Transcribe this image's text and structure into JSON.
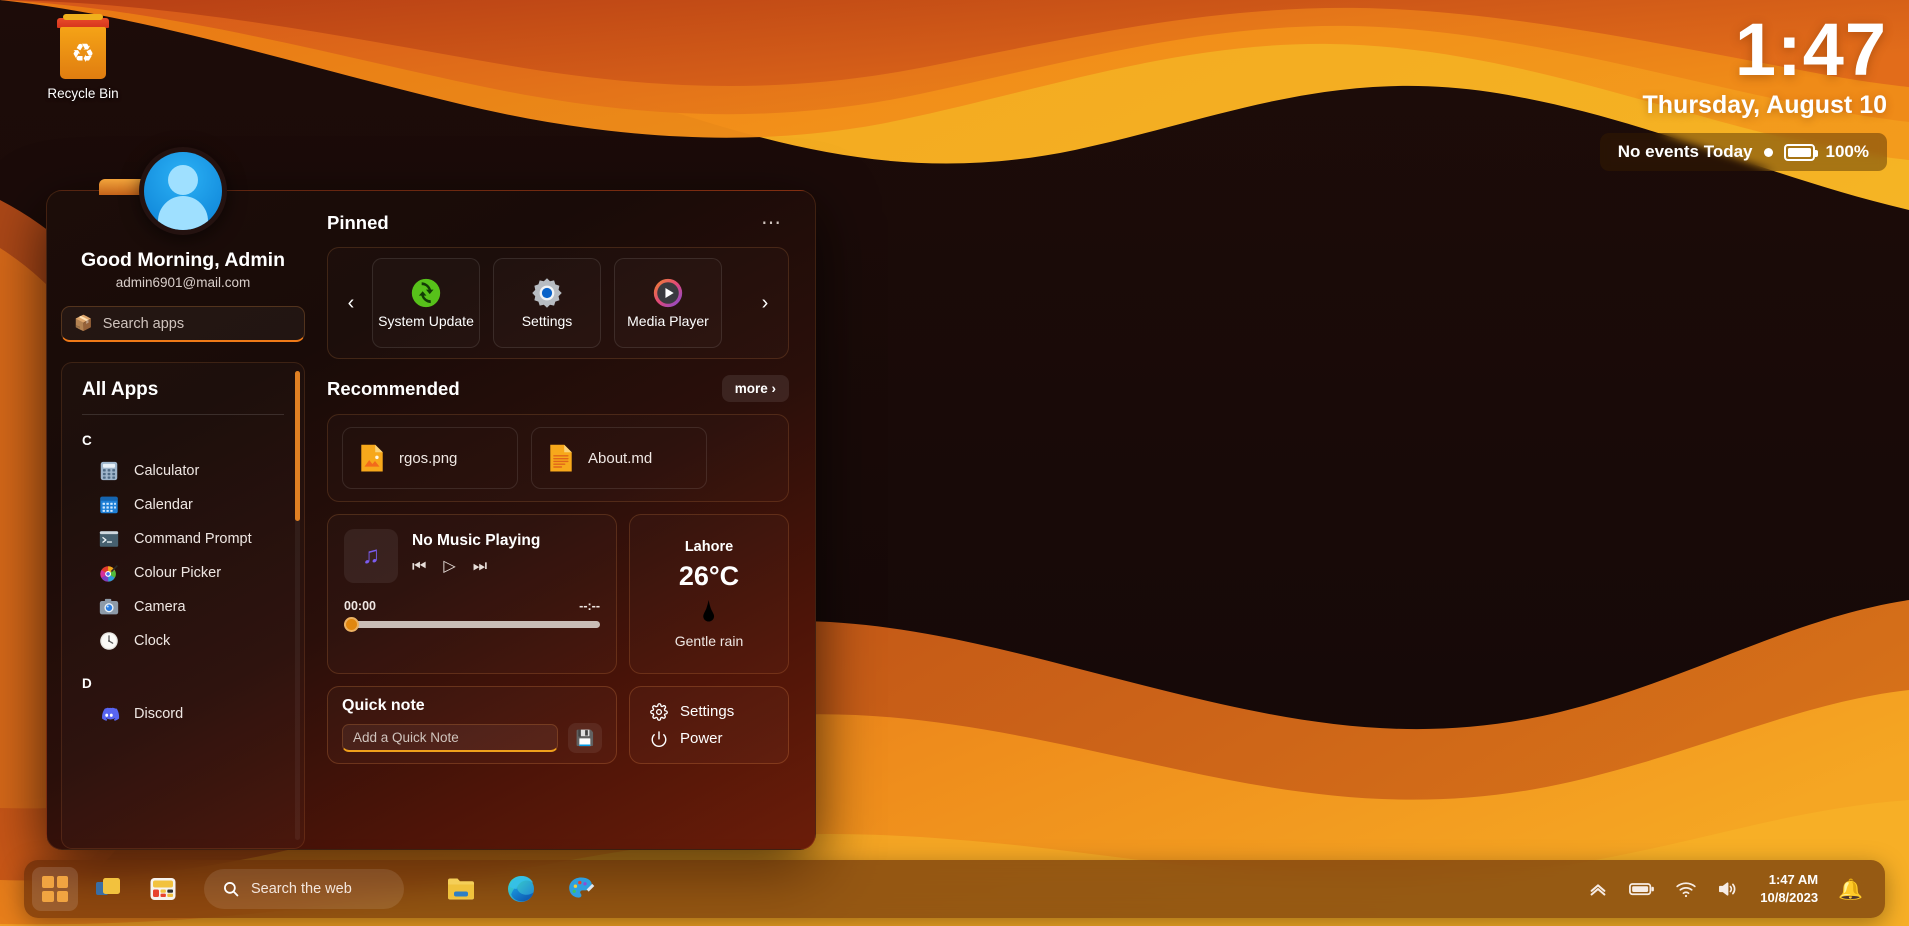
{
  "desktop": {
    "recycle_bin_label": "Recycle Bin",
    "recycle_bin_icon": "recycle-bin-icon"
  },
  "clock_widget": {
    "time": "1:47",
    "date": "Thursday, August 10",
    "events_text": "No events Today",
    "battery_percent": "100%",
    "battery_icon": "battery-full-icon"
  },
  "start_menu": {
    "user": {
      "greeting": "Good Morning, Admin",
      "email": "admin6901@mail.com",
      "avatar_icon": "user-avatar-icon"
    },
    "search": {
      "placeholder": "Search apps",
      "icon": "app-stack-icon"
    },
    "all_apps": {
      "title": "All Apps",
      "groups": [
        {
          "letter": "C",
          "apps": [
            {
              "name": "Calculator",
              "icon": "calculator-icon"
            },
            {
              "name": "Calendar",
              "icon": "calendar-icon"
            },
            {
              "name": "Command Prompt",
              "icon": "terminal-icon"
            },
            {
              "name": "Colour Picker",
              "icon": "color-wheel-icon"
            },
            {
              "name": "Camera",
              "icon": "camera-icon"
            },
            {
              "name": "Clock",
              "icon": "clock-icon"
            }
          ]
        },
        {
          "letter": "D",
          "apps": [
            {
              "name": "Discord",
              "icon": "discord-icon"
            }
          ]
        }
      ]
    },
    "pinned": {
      "title": "Pinned",
      "overflow_icon": "more-dots-icon",
      "prev_icon": "chevron-left-icon",
      "next_icon": "chevron-right-icon",
      "tiles": [
        {
          "label": "System Update",
          "icon": "system-update-icon"
        },
        {
          "label": "Settings",
          "icon": "gear-icon"
        },
        {
          "label": "Media Player",
          "icon": "play-circle-icon"
        }
      ]
    },
    "recommended": {
      "title": "Recommended",
      "more_label": "more ›",
      "items": [
        {
          "name": "rgos.png",
          "icon": "image-file-icon"
        },
        {
          "name": "About.md",
          "icon": "text-file-icon"
        }
      ]
    },
    "music": {
      "title": "No Music Playing",
      "art_icon": "music-note-icon",
      "prev_icon": "skip-back-icon",
      "play_icon": "play-icon",
      "next_icon": "skip-forward-icon",
      "elapsed": "00:00",
      "duration": "--:--",
      "progress_percent": 0
    },
    "weather": {
      "city": "Lahore",
      "temperature": "26°C",
      "condition": "Gentle rain",
      "icon": "rain-cloud-night-icon"
    },
    "quick_note": {
      "title": "Quick note",
      "placeholder": "Add a Quick Note",
      "value": "",
      "save_icon": "floppy-save-icon"
    },
    "power_panel": {
      "settings_label": "Settings",
      "settings_icon": "gear-icon",
      "power_label": "Power",
      "power_icon": "power-icon"
    }
  },
  "taskbar": {
    "start_icon": "windows-start-icon",
    "task_view_icon": "task-view-icon",
    "widgets_icon": "widgets-icon",
    "search": {
      "placeholder": "Search the web",
      "icon": "search-icon"
    },
    "apps": [
      {
        "name": "File Explorer",
        "icon": "file-explorer-icon"
      },
      {
        "name": "Microsoft Edge",
        "icon": "edge-icon"
      },
      {
        "name": "Paint",
        "icon": "paint-icon"
      }
    ],
    "tray": [
      {
        "name": "show-hidden-icons",
        "icon": "chevron-up-icon"
      },
      {
        "name": "battery",
        "icon": "battery-icon"
      },
      {
        "name": "network",
        "icon": "wifi-icon"
      },
      {
        "name": "volume",
        "icon": "speaker-icon"
      }
    ],
    "clock": {
      "time": "1:47 AM",
      "date": "10/8/2023"
    },
    "notifications_icon": "bell-icon"
  },
  "theme": {
    "accent": "#ef7a18",
    "wallpaper_top": "#f5a623",
    "wallpaper_mid": "#e2641a",
    "wallpaper_dark": "#1b0b08"
  }
}
